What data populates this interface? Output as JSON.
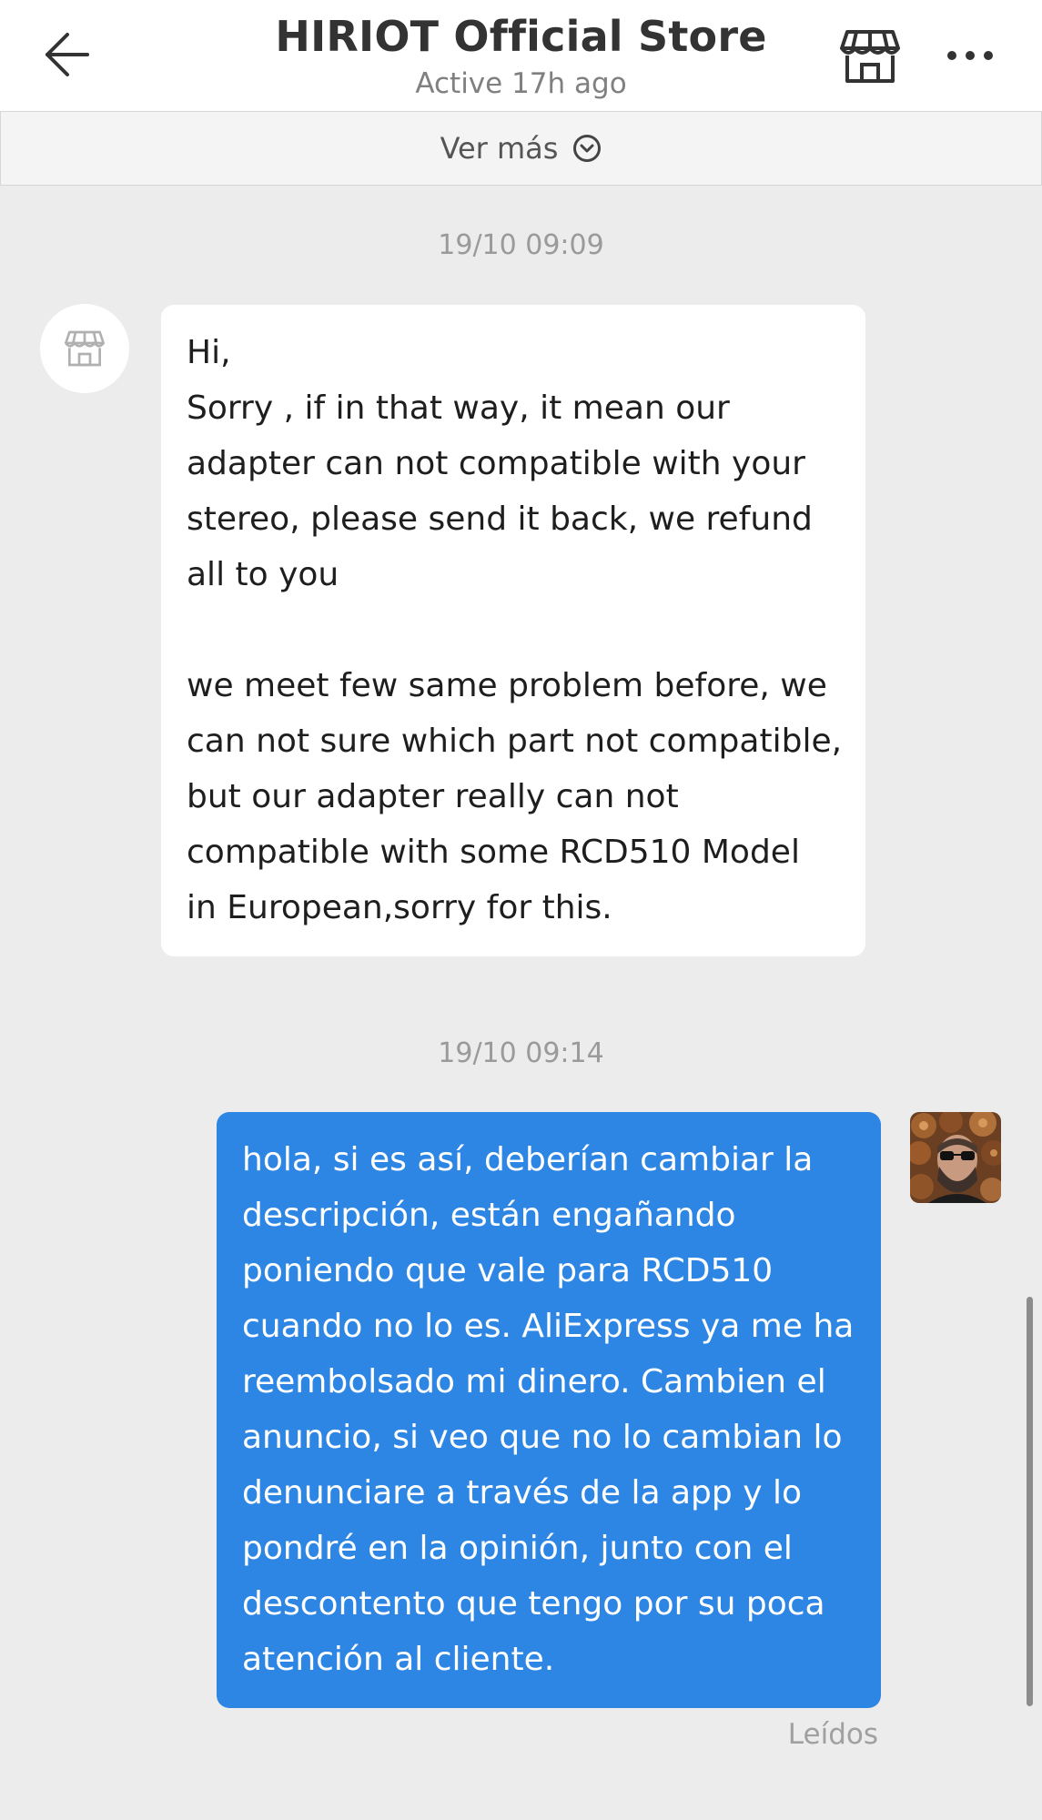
{
  "header": {
    "title": "HIRIOT Official Store",
    "status": "Active 17h ago",
    "back_icon": "arrow-left-icon",
    "store_icon": "storefront-icon",
    "more_icon": "more-horizontal-icon"
  },
  "ver_mas": {
    "label": "Ver más",
    "icon": "chevron-down-circle-icon"
  },
  "messages": [
    {
      "timestamp": "19/10 09:09",
      "sender": "store",
      "avatar_icon": "storefront-icon",
      "lines": [
        "Hi,",
        "Sorry , if in that way, it mean our",
        "adapter can not compatible with your",
        "stereo, please send it back, we refund",
        "all to you",
        "",
        "we meet few same problem before, we",
        "can not sure which part not compatible,",
        "but our adapter really can not",
        "compatible with some RCD510 Model",
        "in European,sorry for this."
      ]
    },
    {
      "timestamp": "19/10 09:14",
      "sender": "user",
      "avatar_icon": "user-photo-avatar",
      "lines": [
        "hola, si es así, deberían cambiar la",
        "descripción, están engañando",
        "poniendo que vale para RCD510",
        "cuando no lo es. AliExpress ya me ha",
        "reembolsado mi dinero. Cambien el",
        "anuncio, si veo que no lo cambian lo",
        "denunciare a través de la app y lo",
        "pondré en la opinión, junto con el",
        "descontento que tengo por su poca",
        "atención al cliente."
      ],
      "read_status": "Leídos"
    }
  ],
  "colors": {
    "background": "#ececec",
    "incoming_bubble": "#ffffff",
    "outgoing_bubble": "#2e86e4",
    "title_text": "#333333",
    "muted_text": "#9a9a9a"
  }
}
